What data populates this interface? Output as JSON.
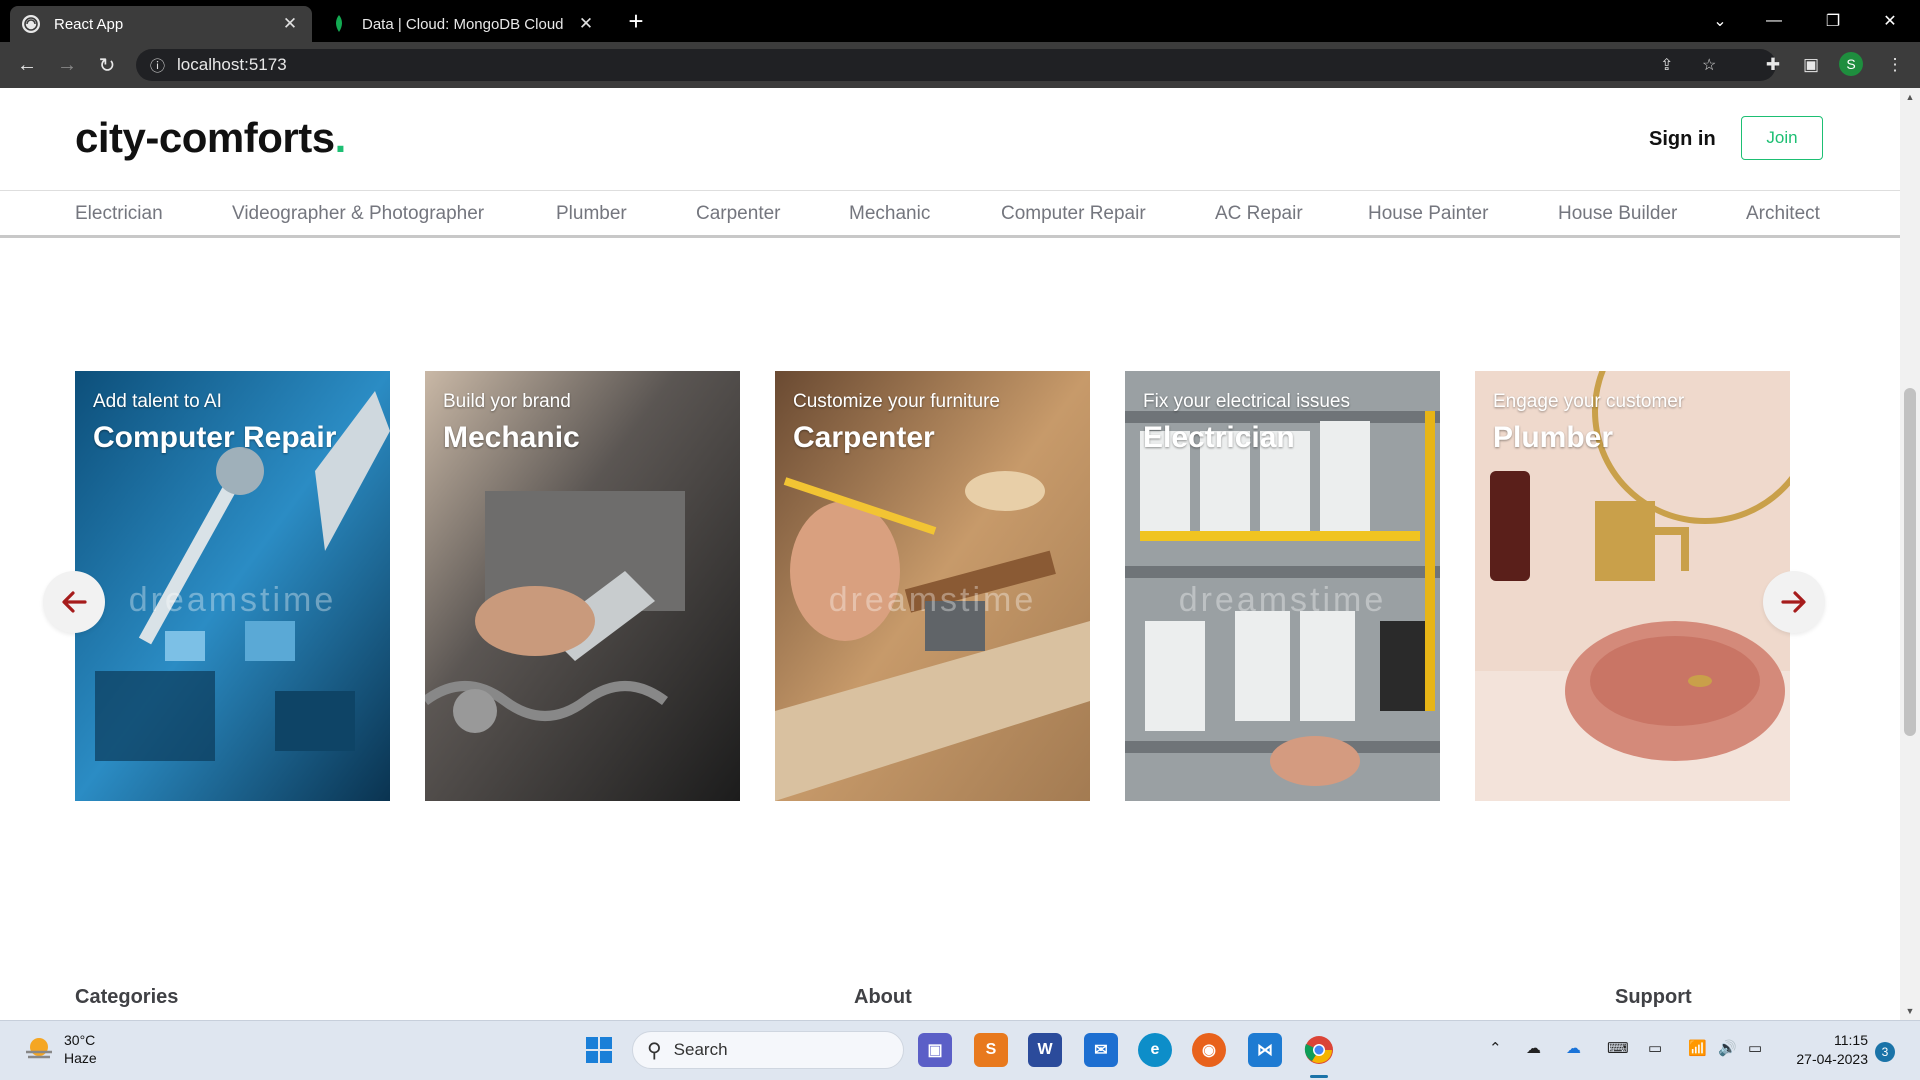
{
  "browser": {
    "tabs": [
      {
        "title": "React App",
        "active": true
      },
      {
        "title": "Data | Cloud: MongoDB Cloud",
        "active": false
      }
    ],
    "url": "localhost:5173",
    "profile_initial": "S"
  },
  "header": {
    "logo_text": "city-comforts",
    "logo_dot": ".",
    "signin_label": "Sign in",
    "join_label": "Join"
  },
  "categories": [
    "Electrician",
    "Videographer & Photographer",
    "Plumber",
    "Carpenter",
    "Mechanic",
    "Computer Repair",
    "AC Repair",
    "House Painter",
    "House Builder",
    "Architect"
  ],
  "slides": [
    {
      "subtitle": "Add talent to AI",
      "title": "Computer Repair",
      "watermark": "dreamstime"
    },
    {
      "subtitle": "Build yor brand",
      "title": "Mechanic",
      "watermark": ""
    },
    {
      "subtitle": "Customize your furniture",
      "title": "Carpenter",
      "watermark": "dreamstime"
    },
    {
      "subtitle": "Fix your electrical issues",
      "title": "Electrician",
      "watermark": "dreamstime"
    },
    {
      "subtitle": "Engage your customer",
      "title": "Plumber",
      "watermark": ""
    }
  ],
  "footer": {
    "categories_heading": "Categories",
    "about_heading": "About",
    "support_heading": "Support"
  },
  "taskbar": {
    "weather_temp": "30°C",
    "weather_desc": "Haze",
    "search_label": "Search",
    "time": "11:15",
    "date": "27-04-2023",
    "notification_count": "3"
  },
  "colors": {
    "brand_green": "#1dbf73",
    "arrow_red": "#a61c1c",
    "category_text": "#74767e"
  }
}
